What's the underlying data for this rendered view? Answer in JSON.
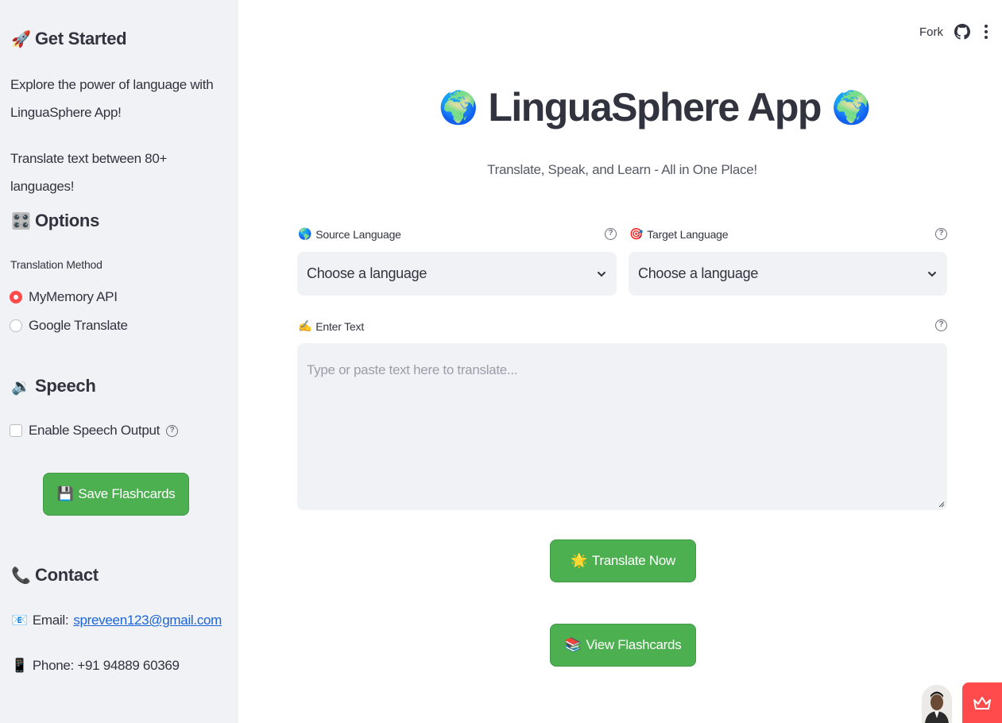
{
  "sidebar": {
    "get_started": {
      "emoji": "🚀",
      "title": "Get Started"
    },
    "intro_text": "Explore the power of language with LinguaSphere App!",
    "translate_text": "Translate text between 80+ languages!",
    "options": {
      "emoji": "🎛️",
      "title": "Options"
    },
    "translation_method_label": "Translation Method",
    "methods": [
      {
        "label": "MyMemory API",
        "selected": true
      },
      {
        "label": "Google Translate",
        "selected": false
      }
    ],
    "speech": {
      "emoji": "🔉",
      "title": "Speech"
    },
    "speech_checkbox_label": "Enable Speech Output",
    "save_button": {
      "emoji": "💾",
      "label": "Save Flashcards"
    },
    "contact": {
      "emoji": "📞",
      "title": "Contact"
    },
    "email": {
      "emoji": "📧",
      "label": "Email:",
      "value": "spreveen123@gmail.com"
    },
    "phone": {
      "emoji": "📱",
      "label": "Phone: +91 94889 60369"
    }
  },
  "header": {
    "fork_label": "Fork"
  },
  "main": {
    "title": "LinguaSphere App",
    "title_emoji": "🌍",
    "subtitle": "Translate, Speak, and Learn - All in One Place!",
    "source_language": {
      "emoji": "🌎",
      "label": "Source Language",
      "placeholder": "Choose a language"
    },
    "target_language": {
      "emoji": "🎯",
      "label": "Target Language",
      "placeholder": "Choose a language"
    },
    "enter_text": {
      "emoji": "✍️",
      "label": "Enter Text",
      "placeholder": "Type or paste text here to translate..."
    },
    "translate_button": {
      "emoji": "🌟",
      "label": "Translate Now"
    },
    "flashcards_button": {
      "emoji": "📚",
      "label": "View Flashcards"
    }
  },
  "colors": {
    "accent_red": "#ff4b4b",
    "button_green": "#4caf50",
    "sidebar_bg": "#f0f2f6",
    "link_blue": "#1a64d8"
  }
}
